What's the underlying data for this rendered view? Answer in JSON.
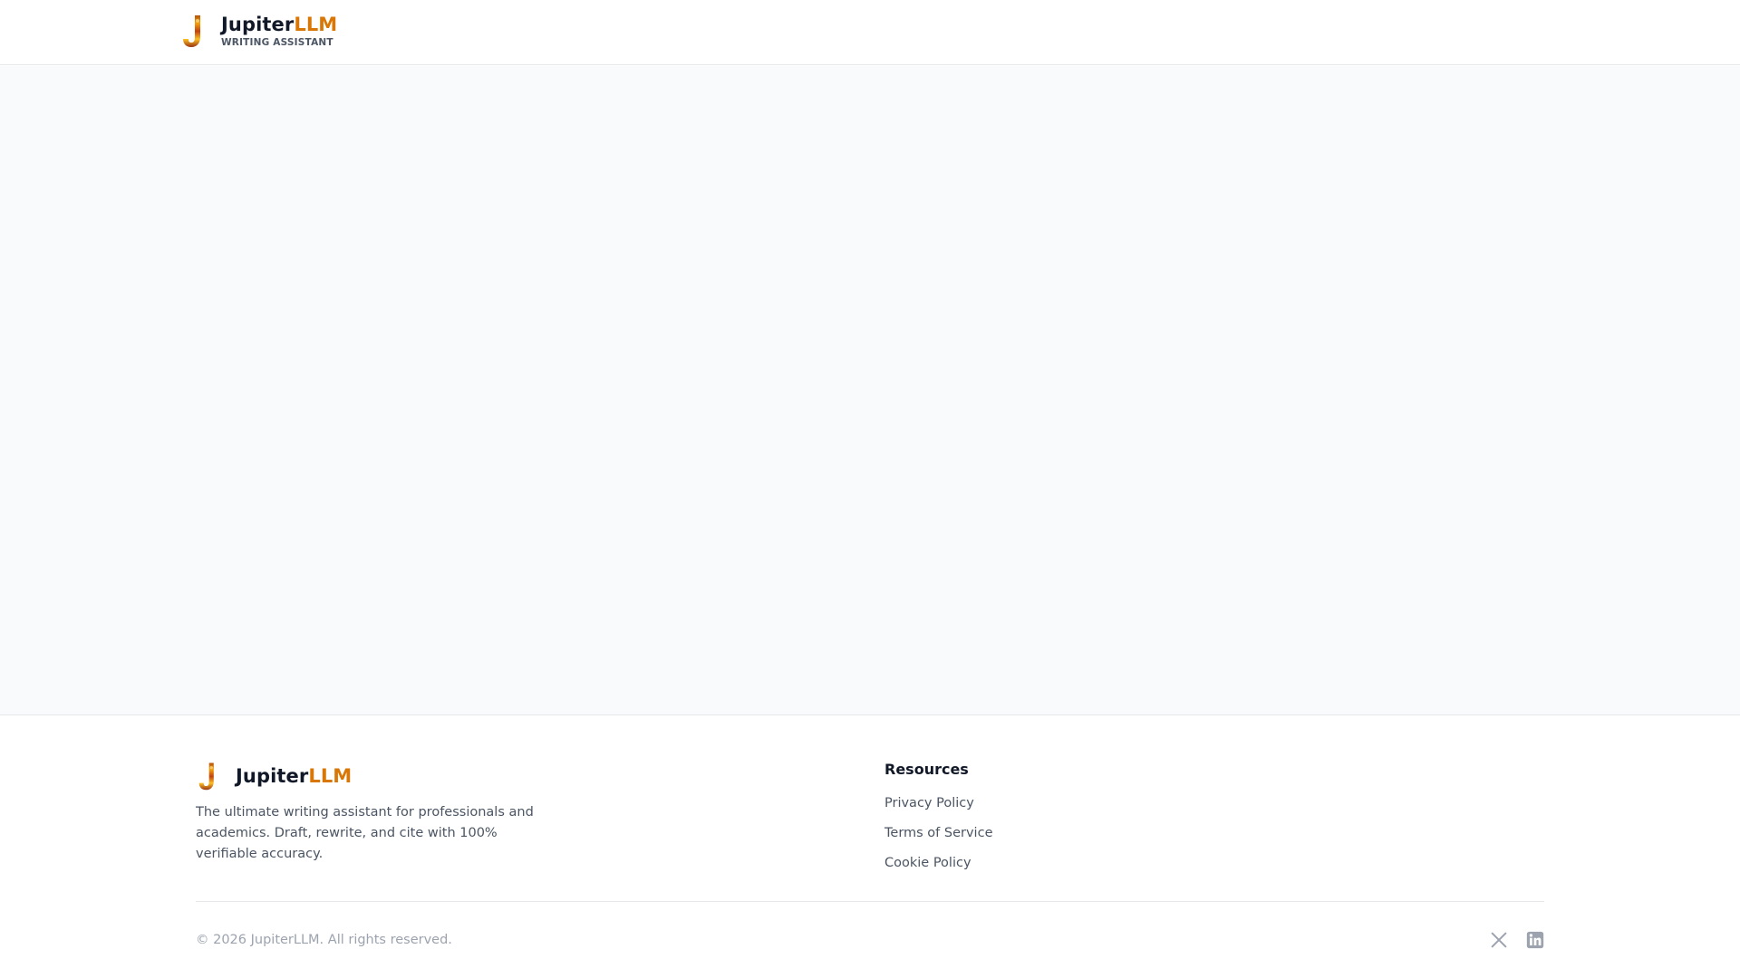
{
  "header": {
    "brand": {
      "name_primary": "Jupiter",
      "name_accent": "LLM",
      "tagline": "WRITING ASSISTANT"
    }
  },
  "footer": {
    "brand": {
      "name_primary": "Jupiter",
      "name_accent": "LLM"
    },
    "description": "The ultimate writing assistant for professionals and academics. Draft, rewrite, and cite with 100% verifiable accuracy.",
    "resources": {
      "title": "Resources",
      "links": [
        {
          "label": "Privacy Policy"
        },
        {
          "label": "Terms of Service"
        },
        {
          "label": "Cookie Policy"
        }
      ]
    },
    "copyright": "© 2026 JupiterLLM. All rights reserved.",
    "socials": [
      {
        "icon": "x-twitter-icon"
      },
      {
        "icon": "linkedin-icon"
      }
    ]
  },
  "colors": {
    "accent": "#d97706",
    "text_primary": "#111827",
    "text_secondary": "#4b5563",
    "text_muted": "#9ca3af",
    "main_background": "#f8fafc",
    "border": "#e5e7eb"
  }
}
